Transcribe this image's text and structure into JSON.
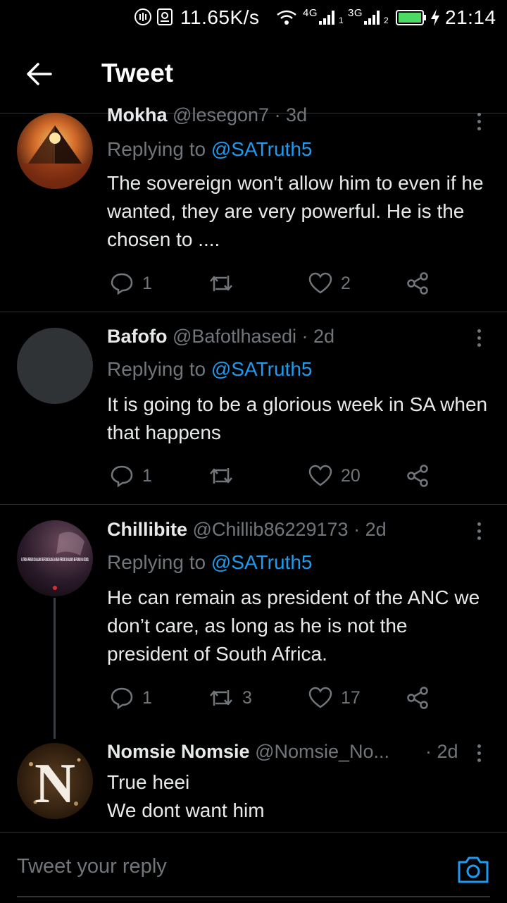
{
  "status_bar": {
    "speed": "11.65K/s",
    "net1": "4G",
    "net2": "3G",
    "sim1": "1",
    "sim2": "2",
    "time": "21:14"
  },
  "header": {
    "title": "Tweet"
  },
  "colors": {
    "accent": "#1d9bf0",
    "muted": "#71767b",
    "text": "#e7e9ea",
    "background": "#000000"
  },
  "tweets": [
    {
      "name": "Mokha",
      "handle": "@lesegon7",
      "age": "· 3d",
      "replying_prefix": "Replying to",
      "mention": "@SATruth5",
      "body": "The sovereign won't allow him to even if he wanted, they are very powerful. He is the chosen to ....",
      "replies": "1",
      "retweets": "",
      "likes": "2"
    },
    {
      "name": "Bafofo",
      "handle": "@Bafotlhasedi",
      "age": "· 2d",
      "replying_prefix": "Replying to",
      "mention": "@SATruth5",
      "body": "It is going to be a glorious week in SA when that happens",
      "replies": "1",
      "retweets": "",
      "likes": "20"
    },
    {
      "name": "Chillibite",
      "handle": "@Chillib86229173",
      "age": "· 2d",
      "replying_prefix": "Replying to",
      "mention": "@SATruth5",
      "body": "He can remain as president of the ANC we don’t care, as long as he is not the president of South Africa.",
      "replies": "1",
      "retweets": "3",
      "likes": "17",
      "avatar_text": "A STRONG PERSON CAN ALWAYS BE FOUND ALONE. A WEAK PERSON CAN ALWAYS BE FOUND IN A CROWD."
    },
    {
      "name": "Nomsie Nomsie",
      "handle": "@Nomsie_No...",
      "age": "· 2d",
      "body_line1": "True heei",
      "body_line2": "We dont want him",
      "avatar_letter": "N"
    }
  ],
  "reply_bar": {
    "placeholder": "Tweet your reply"
  }
}
